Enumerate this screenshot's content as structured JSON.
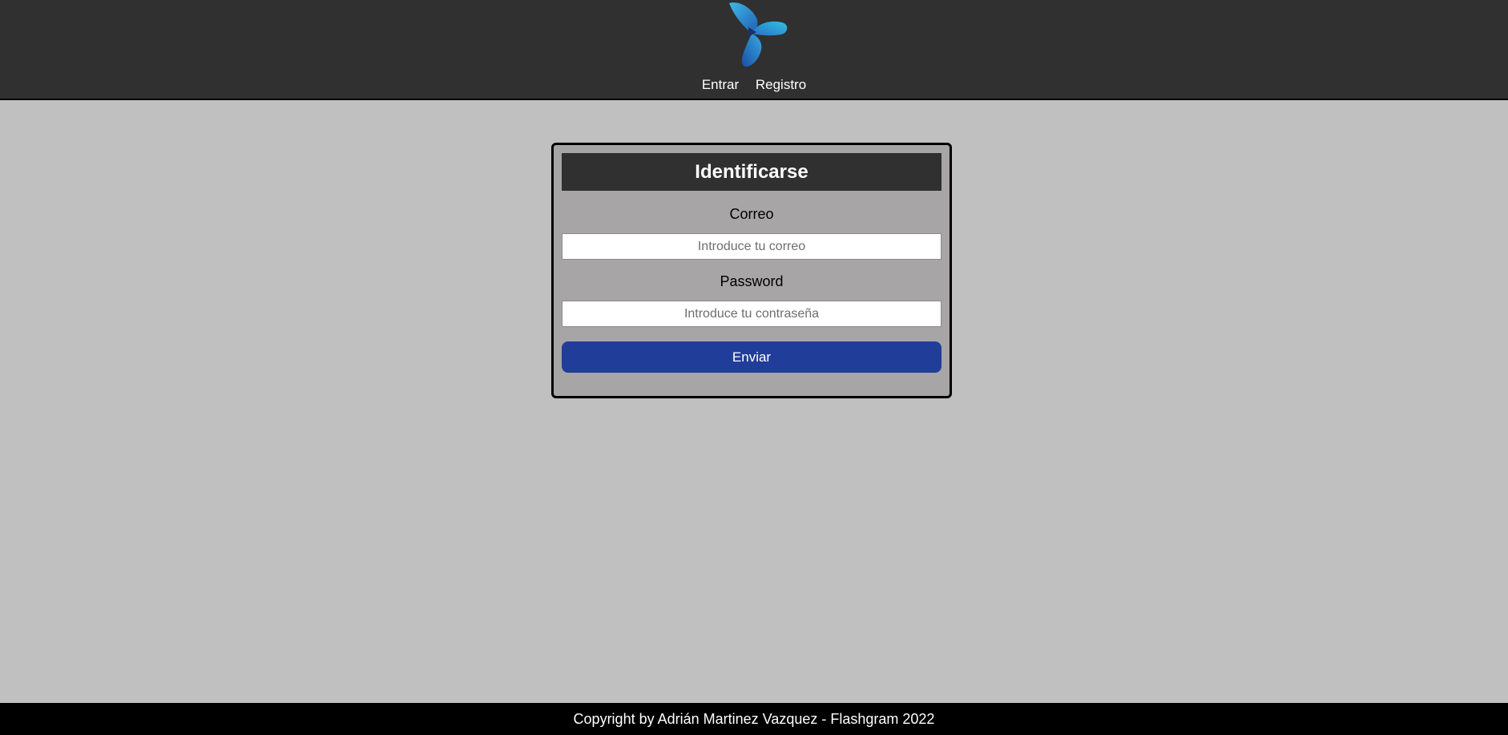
{
  "header": {
    "logo_icon": "flashgram-logo-icon",
    "nav": [
      {
        "label": "Entrar"
      },
      {
        "label": "Registro"
      }
    ]
  },
  "login_form": {
    "title": "Identificarse",
    "email": {
      "label": "Correo",
      "value": "",
      "placeholder": "Introduce tu correo"
    },
    "password": {
      "label": "Password",
      "value": "",
      "placeholder": "Introduce tu contraseña"
    },
    "submit_label": "Enviar"
  },
  "footer": {
    "text": "Copyright by Adrián Martinez Vazquez - Flashgram 2022"
  },
  "colors": {
    "header_bg": "#303030",
    "page_bg": "#c0c0c0",
    "card_bg": "#a7a5a5",
    "button_bg": "#213d9a",
    "logo_blue": "#2a9fd8"
  }
}
